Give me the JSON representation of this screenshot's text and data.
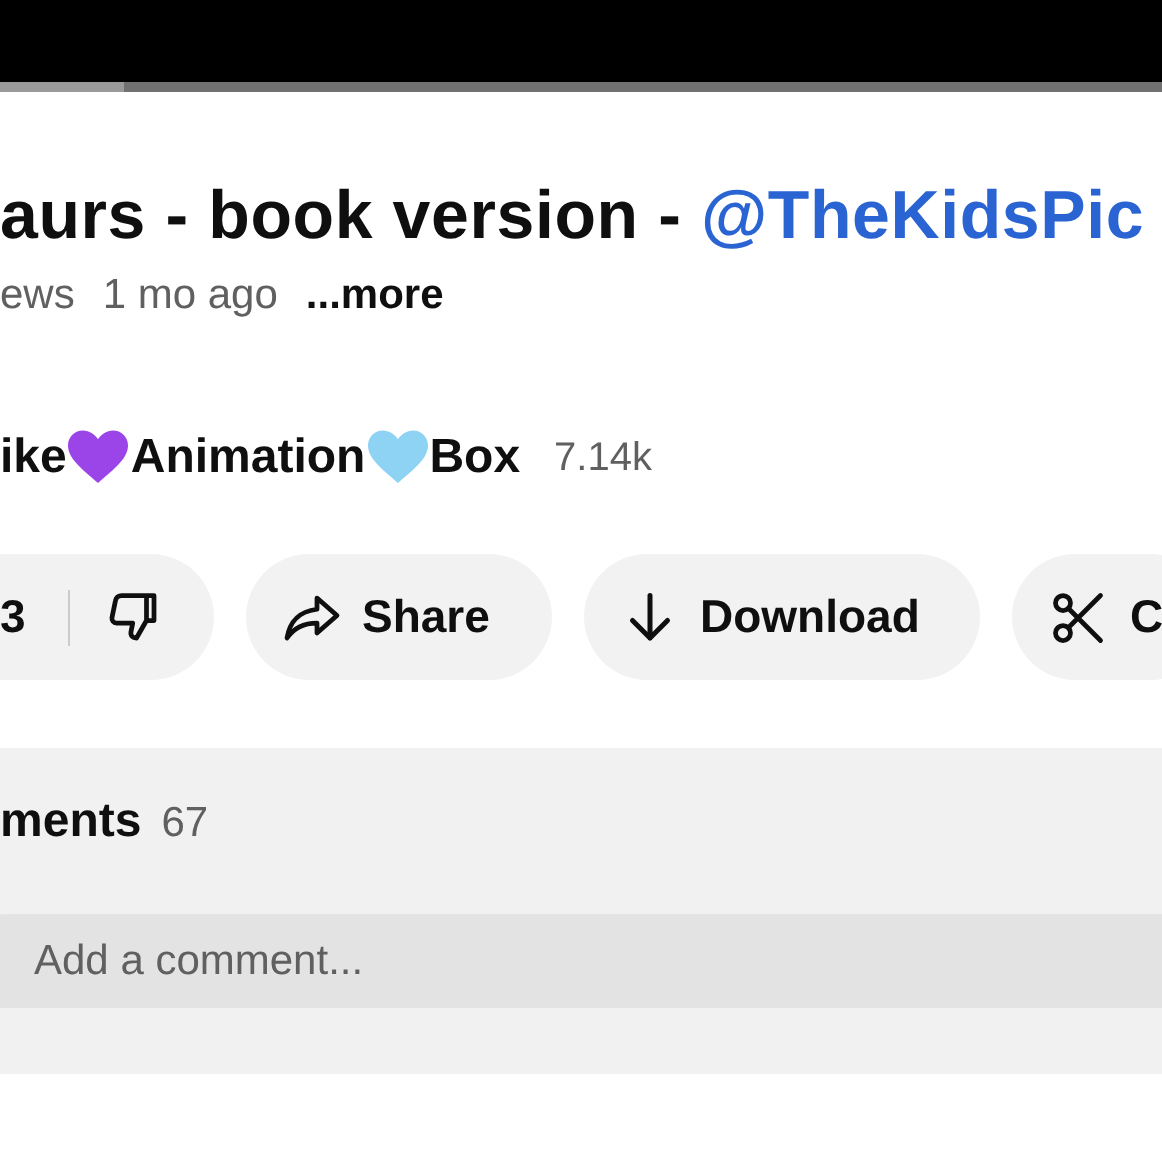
{
  "player": {
    "progress": {
      "level": 0.107
    }
  },
  "video": {
    "title": "aurs - book version - ",
    "title_link": "@TheKidsPic",
    "views": "ews",
    "age": "1 mo ago",
    "more": "...more"
  },
  "channel": {
    "name_parts": [
      {
        "kind": "text",
        "text": "ike"
      },
      {
        "kind": "heart",
        "color": "#9b45e8"
      },
      {
        "kind": "text",
        "text": "Animation"
      },
      {
        "kind": "heart",
        "color": "#8fd3f4"
      },
      {
        "kind": "text",
        "text": "Box"
      }
    ],
    "subscribers": "7.14k"
  },
  "actions": [
    {
      "kind": "like",
      "count": "3"
    },
    {
      "kind": "share",
      "label": "Share"
    },
    {
      "kind": "download",
      "label": "Download"
    },
    {
      "kind": "clip",
      "label": "C"
    }
  ],
  "comments": {
    "heading": "ments",
    "count": "67",
    "placeholder": "Add a comment..."
  }
}
